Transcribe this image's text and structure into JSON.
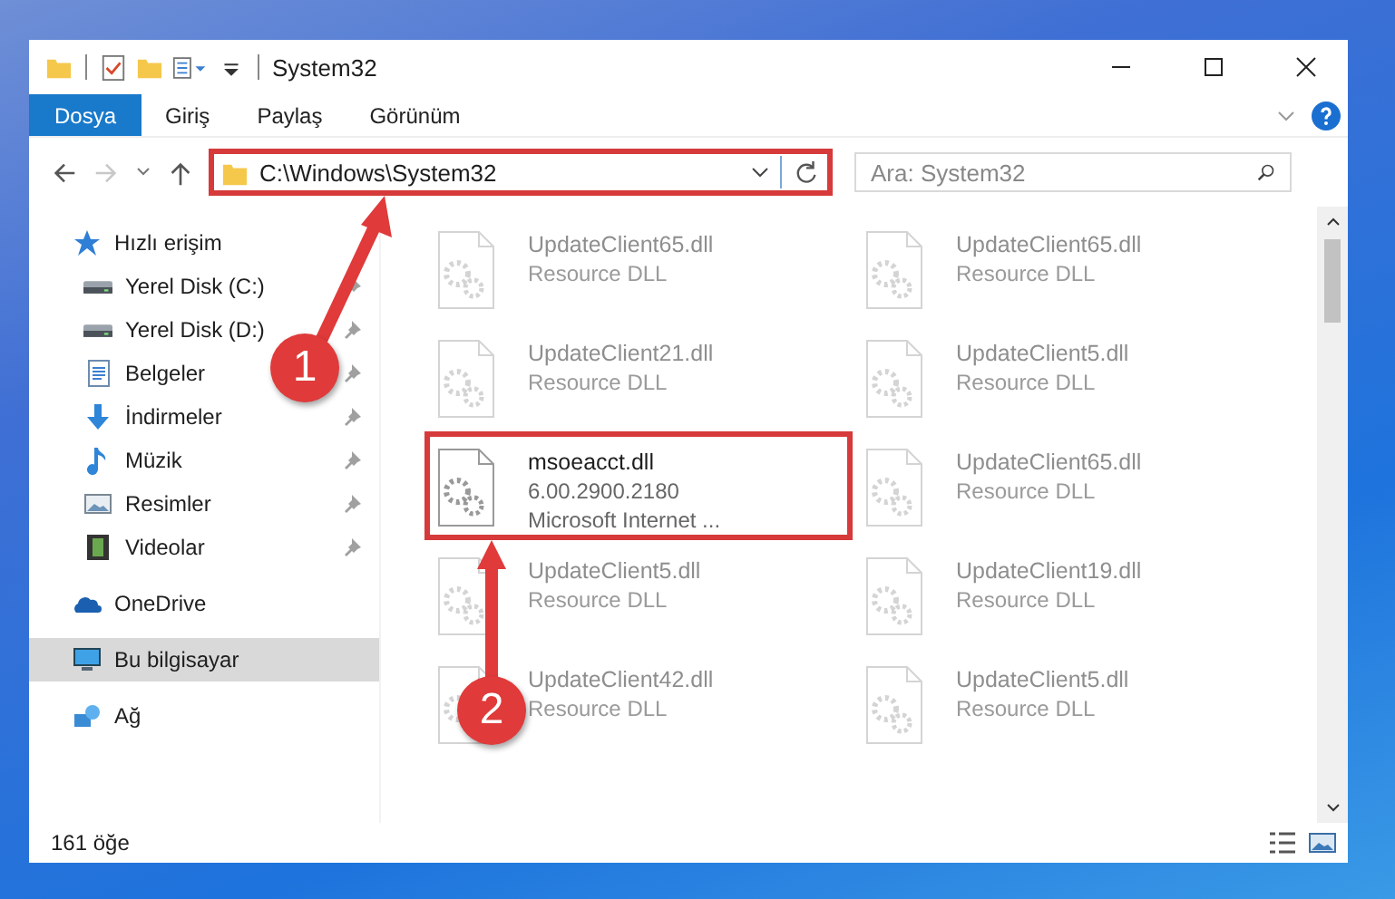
{
  "window": {
    "title": "System32"
  },
  "ribbon_tabs": [
    {
      "label": "Dosya",
      "selected": true
    },
    {
      "label": "Giriş",
      "selected": false
    },
    {
      "label": "Paylaş",
      "selected": false
    },
    {
      "label": "Görünüm",
      "selected": false
    }
  ],
  "address": {
    "path": "C:\\Windows\\System32",
    "highlighted": true
  },
  "search": {
    "placeholder": "Ara: System32"
  },
  "sidebar": {
    "items": [
      {
        "label": "Hızlı erişim",
        "kind": "star",
        "selected": false,
        "children": [
          {
            "label": "Yerel Disk (C:)",
            "kind": "disk",
            "pinned": true,
            "selected": false
          },
          {
            "label": "Yerel Disk (D:)",
            "kind": "disk",
            "pinned": true,
            "selected": false
          },
          {
            "label": "Belgeler",
            "kind": "document",
            "pinned": true,
            "selected": false
          },
          {
            "label": "İndirmeler",
            "kind": "download",
            "pinned": true,
            "selected": false
          },
          {
            "label": "Müzik",
            "kind": "music",
            "pinned": true,
            "selected": false
          },
          {
            "label": "Resimler",
            "kind": "picture",
            "pinned": true,
            "selected": false
          },
          {
            "label": "Videolar",
            "kind": "video",
            "pinned": true,
            "selected": false
          }
        ]
      },
      {
        "label": "OneDrive",
        "kind": "cloud",
        "selected": false
      },
      {
        "label": "Bu bilgisayar",
        "kind": "computer",
        "selected": true
      },
      {
        "label": "Ağ",
        "kind": "network",
        "selected": false
      }
    ]
  },
  "files": [
    {
      "name": "UpdateClient65.dll",
      "details": [
        "Resource DLL"
      ],
      "dimmed": true,
      "highlighted": false
    },
    {
      "name": "UpdateClient65.dll",
      "details": [
        "Resource DLL"
      ],
      "dimmed": true,
      "highlighted": false
    },
    {
      "name": "UpdateClient21.dll",
      "details": [
        "Resource DLL"
      ],
      "dimmed": true,
      "highlighted": false
    },
    {
      "name": "UpdateClient5.dll",
      "details": [
        "Resource DLL"
      ],
      "dimmed": true,
      "highlighted": false
    },
    {
      "name": "msoeacct.dll",
      "details": [
        "6.00.2900.2180",
        "Microsoft Internet ..."
      ],
      "dimmed": false,
      "highlighted": true
    },
    {
      "name": "UpdateClient65.dll",
      "details": [
        "Resource DLL"
      ],
      "dimmed": true,
      "highlighted": false
    },
    {
      "name": "UpdateClient5.dll",
      "details": [
        "Resource DLL"
      ],
      "dimmed": true,
      "highlighted": false
    },
    {
      "name": "UpdateClient19.dll",
      "details": [
        "Resource DLL"
      ],
      "dimmed": true,
      "highlighted": false
    },
    {
      "name": "UpdateClient42.dll",
      "details": [
        "Resource DLL"
      ],
      "dimmed": true,
      "highlighted": false
    },
    {
      "name": "UpdateClient5.dll",
      "details": [
        "Resource DLL"
      ],
      "dimmed": true,
      "highlighted": false
    }
  ],
  "status_bar": {
    "item_count": "161 öğe"
  },
  "annotations": [
    {
      "number": "1"
    },
    {
      "number": "2"
    }
  ]
}
